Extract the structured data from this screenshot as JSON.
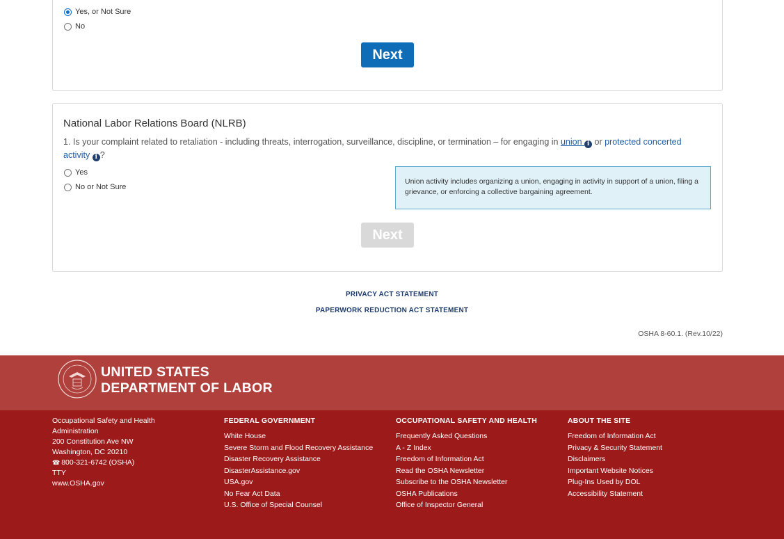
{
  "card1": {
    "options": [
      {
        "label": "Yes, or Not Sure",
        "checked": true
      },
      {
        "label": "No",
        "checked": false
      }
    ],
    "next_label": "Next"
  },
  "card2": {
    "title": "National Labor Relations Board (NLRB)",
    "question": {
      "prefix": "1. Is your complaint related to retaliation - including threats, interrogation, surveillance, discipline, or termination – for engaging in ",
      "union_link": "union ",
      "middle": " or ",
      "protected_link": "protected concerted activity ",
      "suffix": "?"
    },
    "options": [
      {
        "label": "Yes",
        "checked": false
      },
      {
        "label": "No or Not Sure",
        "checked": false
      }
    ],
    "info_box": "Union activity includes organizing a union, engaging in activity in support of a union, filing a grievance, or enforcing a collective bargaining agreement.",
    "next_label": "Next"
  },
  "statements": {
    "privacy": "PRIVACY ACT STATEMENT",
    "paperwork": "PAPERWORK REDUCTION ACT STATEMENT"
  },
  "form_code": "OSHA 8-60.1. (Rev.10/22)",
  "footer": {
    "org_line1": "UNITED STATES",
    "org_line2": "DEPARTMENT OF LABOR",
    "contact": {
      "agency": "Occupational Safety and Health Administration",
      "address1": "200 Constitution Ave NW",
      "address2": "Washington, DC 20210",
      "phone": "800-321-6742 (OSHA)",
      "tty": "TTY",
      "website": "www.OSHA.gov"
    },
    "federal": {
      "heading": "FEDERAL GOVERNMENT",
      "links": [
        "White House",
        "Severe Storm and Flood Recovery Assistance",
        "Disaster Recovery Assistance",
        "DisasterAssistance.gov",
        "USA.gov",
        "No Fear Act Data",
        "U.S. Office of Special Counsel"
      ]
    },
    "osh": {
      "heading": "OCCUPATIONAL SAFETY AND HEALTH",
      "links": [
        "Frequently Asked Questions",
        "A - Z Index",
        "Freedom of Information Act",
        "Read the OSHA Newsletter",
        "Subscribe to the OSHA Newsletter",
        "OSHA Publications",
        "Office of Inspector General"
      ]
    },
    "about": {
      "heading": "ABOUT THE SITE",
      "links": [
        "Freedom of Information Act",
        "Privacy & Security Statement",
        "Disclaimers",
        "Important Website Notices",
        "Plug-Ins Used by DOL",
        "Accessibility Statement"
      ]
    }
  }
}
